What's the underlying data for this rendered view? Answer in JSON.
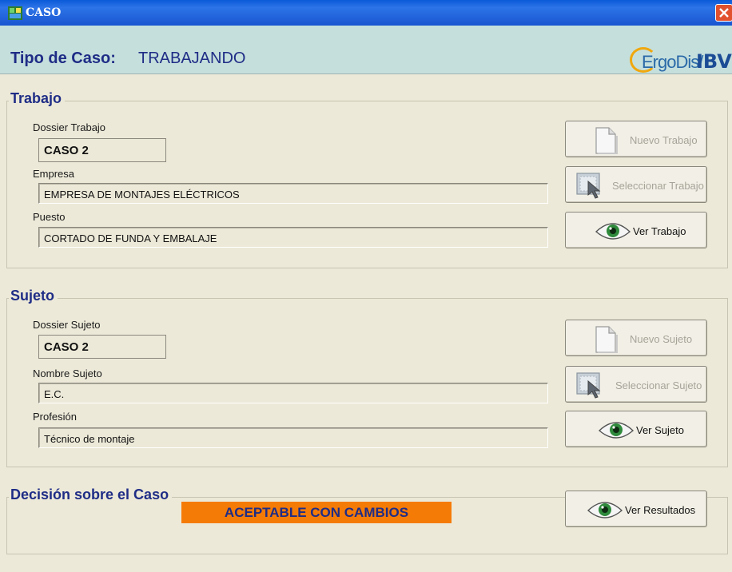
{
  "window": {
    "title": "CASO"
  },
  "header": {
    "tipo_label": "Tipo de Caso:",
    "tipo_value": "TRABAJANDO",
    "logo_text_a": "ErgoDis/",
    "logo_text_b": "IBV"
  },
  "trabajo": {
    "legend": "Trabajo",
    "dossier_label": "Dossier Trabajo",
    "dossier_value": "CASO 2",
    "empresa_label": "Empresa",
    "empresa_value": "EMPRESA DE MONTAJES ELÉCTRICOS",
    "puesto_label": "Puesto",
    "puesto_value": "CORTADO DE FUNDA Y EMBALAJE",
    "btn_nuevo": "Nuevo Trabajo",
    "btn_seleccionar": "Seleccionar Trabajo",
    "btn_ver": "Ver Trabajo"
  },
  "sujeto": {
    "legend": "Sujeto",
    "dossier_label": "Dossier Sujeto",
    "dossier_value": "CASO 2",
    "nombre_label": "Nombre Sujeto",
    "nombre_value": "E.C.",
    "profesion_label": "Profesión",
    "profesion_value": "Técnico de montaje",
    "btn_nuevo": "Nuevo Sujeto",
    "btn_seleccionar": "Seleccionar Sujeto",
    "btn_ver": "Ver Sujeto"
  },
  "decision": {
    "legend": "Decisión sobre el Caso",
    "result": "ACEPTABLE CON CAMBIOS",
    "result_color": "#f57b07",
    "btn_ver": "Ver Resultados"
  },
  "icons": {
    "app": "app-icon",
    "close": "close-icon",
    "new": "new-document-icon",
    "select": "select-cursor-icon",
    "view": "eye-icon"
  }
}
